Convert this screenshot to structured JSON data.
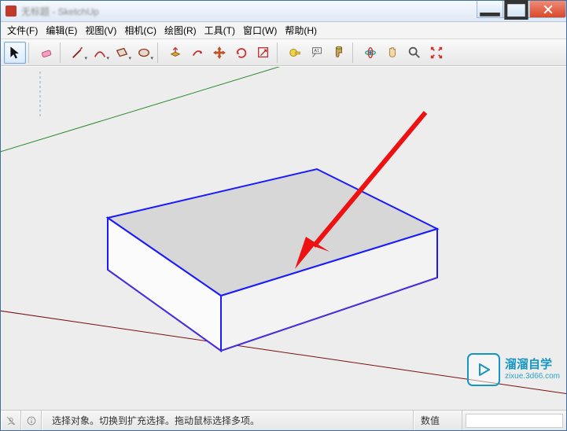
{
  "titlebar": {
    "title": "无标题 - SketchUp"
  },
  "menu": {
    "file": "文件(F)",
    "edit": "编辑(E)",
    "view": "视图(V)",
    "camera": "相机(C)",
    "draw": "绘图(R)",
    "tools": "工具(T)",
    "window": "窗口(W)",
    "help": "帮助(H)"
  },
  "status": {
    "message": "选择对象。切换到扩充选择。拖动鼠标选择多项。",
    "value_label": "数值"
  },
  "watermark": {
    "brand": "溜溜自学",
    "url": "zixue.3d66.com"
  },
  "chart_data": null
}
